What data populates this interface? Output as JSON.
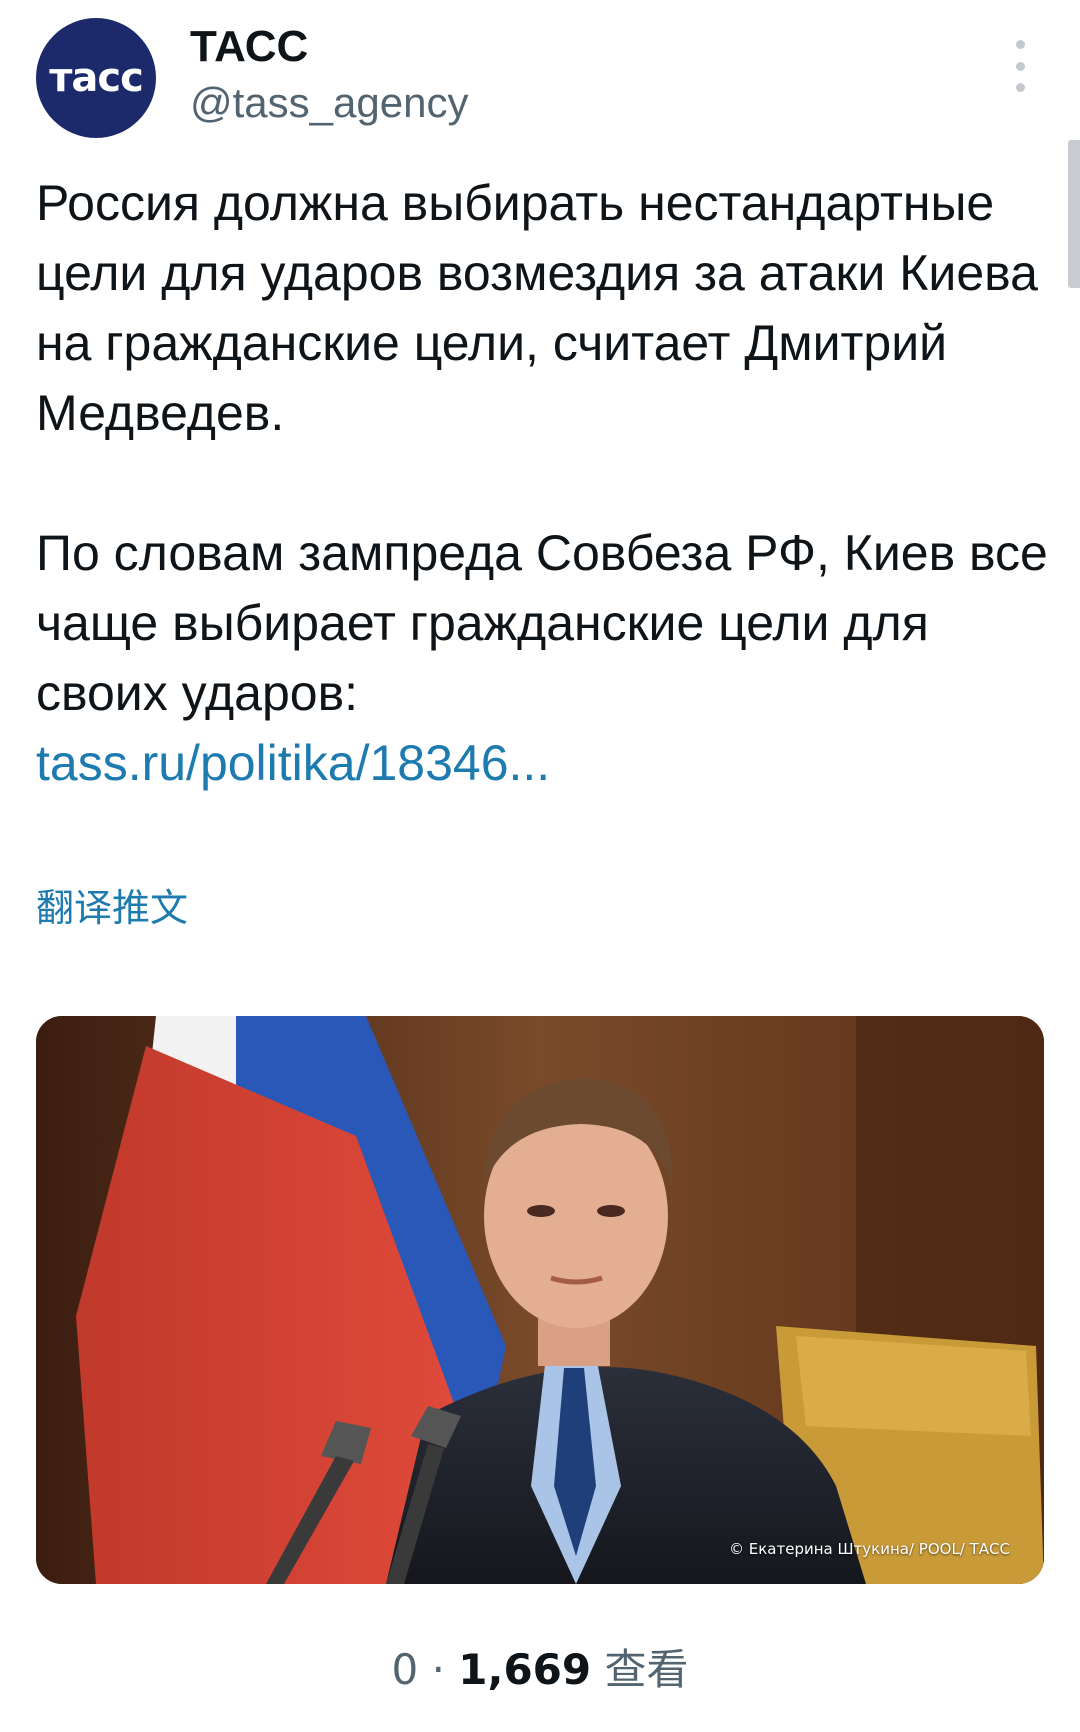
{
  "account": {
    "avatar_text": "тасс",
    "name": "ТАСС",
    "handle": "@tass_agency"
  },
  "tweet": {
    "paragraph1": "Россия должна выбирать нестандартные цели для ударов возмездия за атаки Киева на гражданские цели, считает Дмитрий Медведев.",
    "paragraph2": "По словам зампреда Совбеза РФ, Киев все чаще выбирает гражданские цели для своих ударов:",
    "link": "tass.ru/politika/18346...",
    "translate_label": "翻译推文"
  },
  "media": {
    "photo_credit": "© Екатерина Штукина/ POOL/ ТАСС"
  },
  "stats": {
    "replies": "0",
    "separator": "·",
    "views_count": "1,669",
    "views_label": "查看"
  },
  "colors": {
    "link": "#1d7bb0",
    "secondary_text": "#536471",
    "avatar_bg": "#1c2a6b"
  },
  "icons": [
    "more-dots-icon"
  ]
}
